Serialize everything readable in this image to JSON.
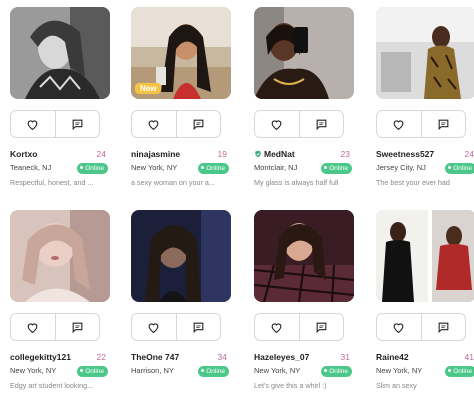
{
  "profiles": [
    {
      "name": "Kortxo",
      "age": "24",
      "location": "Teaneck, NJ",
      "status": "Online",
      "bio": "Respectful, honest, and ...",
      "verified": false,
      "badge": ""
    },
    {
      "name": "ninajasmine",
      "age": "19",
      "location": "New York, NY",
      "status": "Online",
      "bio": "a sexy woman on your a...",
      "verified": false,
      "badge": "New"
    },
    {
      "name": "MedNat",
      "age": "23",
      "location": "Montclair, NJ",
      "status": "Online",
      "bio": "My glass is always half full",
      "verified": true,
      "badge": ""
    },
    {
      "name": "Sweetness527",
      "age": "24",
      "location": "Jersey City, NJ",
      "status": "Online",
      "bio": "The best your ever had",
      "verified": false,
      "badge": ""
    },
    {
      "name": "collegekitty121",
      "age": "22",
      "location": "New York, NY",
      "status": "Online",
      "bio": "Edgy art student looking...",
      "verified": false,
      "badge": ""
    },
    {
      "name": "TheOne 747",
      "age": "34",
      "location": "Harrison, NY",
      "status": "Online",
      "bio": "",
      "verified": false,
      "badge": ""
    },
    {
      "name": "Hazeleyes_07",
      "age": "31",
      "location": "New York, NY",
      "status": "Online",
      "bio": "Let's give this a whirl :)",
      "verified": false,
      "badge": ""
    },
    {
      "name": "Raine42",
      "age": "41",
      "location": "New York, NY",
      "status": "Online",
      "bio": "Slim an sexy",
      "verified": false,
      "badge": ""
    }
  ],
  "icons": {
    "like": "heart-icon",
    "message": "message-icon",
    "verified": "verified-shield-icon"
  },
  "colors": {
    "online": "#4cc78a",
    "age": "#c0699a",
    "new_badge": "#f5c342"
  }
}
